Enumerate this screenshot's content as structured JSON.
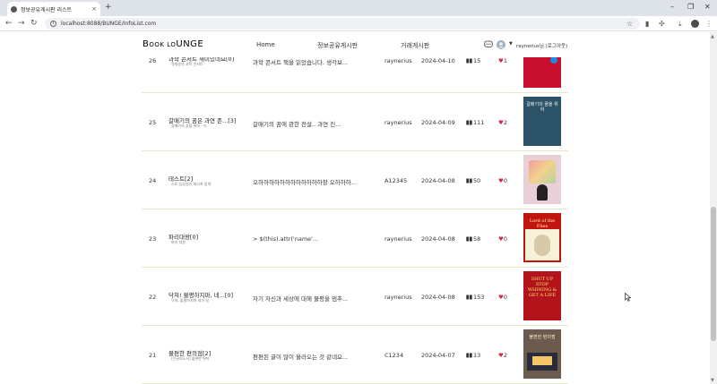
{
  "browser": {
    "tab_title": "정보공유게시판 리스트",
    "tab_close": "×",
    "new_tab": "+",
    "url": "localhost:8088/BUNGE/InfoList.com",
    "win_min": "–",
    "win_max": "❐",
    "win_close": "✕",
    "back": "←",
    "forward": "→",
    "reload": "↻"
  },
  "header": {
    "logo_prefix": "B",
    "logo_small": "OOK LO",
    "logo_suffix": "UNGE",
    "menu": [
      "Home",
      "정보공유게시판",
      "거래게시판"
    ],
    "user_text": "raynerius님 (로그아웃)"
  },
  "posts": [
    {
      "num": "26",
      "title": "과학 콘서트 재미있네요",
      "comments": "[0]",
      "book": "정재승의 과학 콘서트 -",
      "summary": "과학 콘서트 책을 읽었습니다. 생각보...",
      "author": "raynerius",
      "date": "2024-04-10",
      "views": "15",
      "likes": "1"
    },
    {
      "num": "25",
      "title": "갈매기의 꿈은 과연 존...",
      "comments": "[3]",
      "book": "갈매기의 꿈을 위하 - 이",
      "summary": "갈매기의 꿈에 관한 전설.. 과연 진...",
      "author": "raynerius",
      "date": "2024-04-09",
      "views": "111",
      "likes": "2"
    },
    {
      "num": "24",
      "title": "테스트",
      "comments": "[2]",
      "book": "스토 입성실의 회고록 탐색",
      "summary": "오하하하하하하하하하하하하항 오하하하...",
      "author": "A12345",
      "date": "2024-04-08",
      "views": "50",
      "likes": "0"
    },
    {
      "num": "23",
      "title": "파리대왕",
      "comments": "[0]",
      "book": "파리 대왕",
      "summary": "> $(this).attr('name'...",
      "author": "raynerius",
      "date": "2024-04-08",
      "views": "58",
      "likes": "0"
    },
    {
      "num": "22",
      "title": "닥쳐! 불평하지마, 네...",
      "comments": "[0]",
      "book": "닥쳐, 불평하지마 네가 일",
      "summary": "자기 자신과 세상에 대해 불평을 멈추...",
      "author": "raynerius",
      "date": "2024-04-08",
      "views": "153",
      "likes": "0"
    },
    {
      "num": "21",
      "title": "불편한 편의점",
      "comments": "[2]",
      "book": "[큰글자도서] 불편한 편의",
      "summary": "편편된 글이 많이 올라오는 것 같네요...",
      "author": "C1234",
      "date": "2024-04-07",
      "views": "13",
      "likes": "2"
    }
  ],
  "covers": [
    {
      "bg": "#c8102e",
      "text": "",
      "fg": "#ffffff"
    },
    {
      "bg": "#2c5268",
      "text": "갈매기의 꿈을 위하",
      "fg": "#ffffff"
    },
    {
      "bg": "#e9cfd6",
      "text": "",
      "fg": "#444444"
    },
    {
      "bg": "#c0140f",
      "text": "Lord of the Flies",
      "fg": "#fff6c8"
    },
    {
      "bg": "#b3131b",
      "text": "SHUT UP STOP WHINING & GET A LIFE",
      "fg": "#f5e66a"
    },
    {
      "bg": "#6b5b4e",
      "text": "불편한 편의점",
      "fg": "#fff0c8"
    }
  ],
  "colors": {
    "heart": "#d02a4a",
    "row_divider": "#e6eac8"
  }
}
